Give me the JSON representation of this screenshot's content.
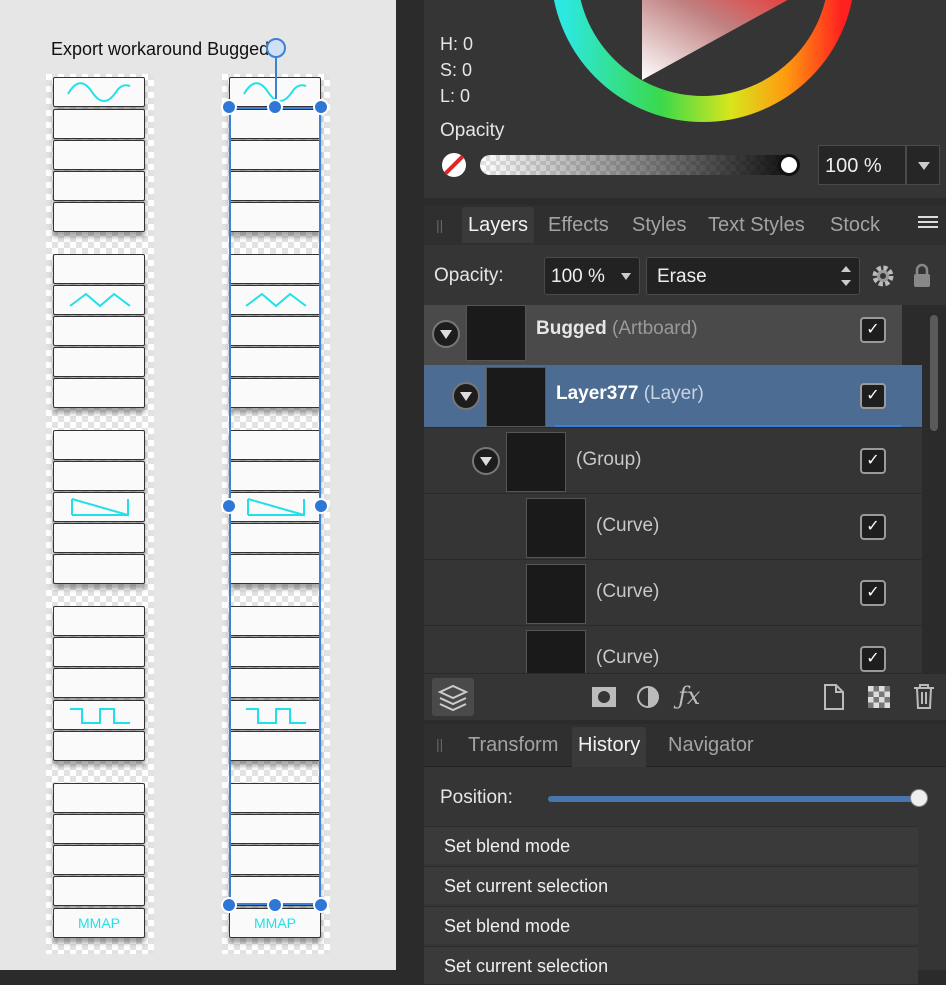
{
  "canvas": {
    "artboard_label": "Export workaround Bugged",
    "mmap_label": "MMAP"
  },
  "color": {
    "h_label": "H:",
    "h_value": "0",
    "s_label": "S:",
    "s_value": "0",
    "l_label": "L:",
    "l_value": "0",
    "opacity_label": "Opacity",
    "opacity_value": "100 %"
  },
  "panel_tabs": [
    "Layers",
    "Effects",
    "Styles",
    "Text Styles",
    "Stock"
  ],
  "layers_toolbar": {
    "opacity_label": "Opacity:",
    "opacity_value": "100 %",
    "blend_mode": "Erase"
  },
  "layers": [
    {
      "name": "Bugged",
      "type": "(Artboard)",
      "checked": true
    },
    {
      "name": "Layer377",
      "type": "(Layer)",
      "checked": true
    },
    {
      "name": "",
      "type": "(Group)",
      "checked": true
    },
    {
      "name": "",
      "type": "(Curve)",
      "checked": true
    },
    {
      "name": "",
      "type": "(Curve)",
      "checked": true
    },
    {
      "name": "",
      "type": "(Curve)",
      "checked": true
    }
  ],
  "bottom_tabs": [
    "Transform",
    "History",
    "Navigator"
  ],
  "history": {
    "position_label": "Position:",
    "position_fraction": 1.0,
    "items": [
      "Set blend mode",
      "Set current selection",
      "Set blend mode",
      "Set current selection"
    ]
  },
  "colors": {
    "accent": "#3b82d6",
    "selected_row": "#4d6c93",
    "waveform": "#22e0e8"
  }
}
